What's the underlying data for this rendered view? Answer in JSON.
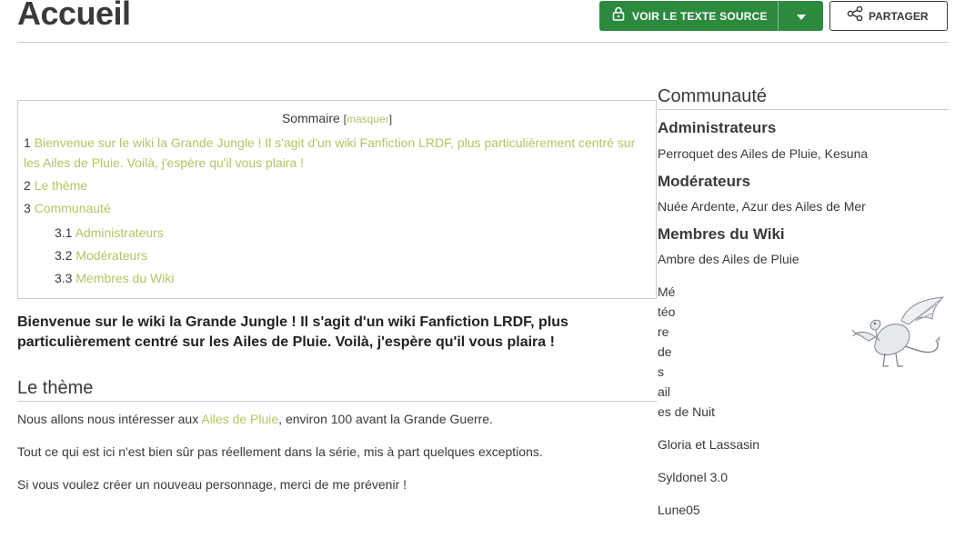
{
  "page": {
    "title": "Accueil"
  },
  "actions": {
    "view_source": "VOIR LE TEXTE SOURCE",
    "share": "PARTAGER"
  },
  "toc": {
    "title": "Sommaire",
    "bracket_open": "[",
    "hide": "masquer",
    "bracket_close": "]",
    "items": [
      {
        "num": "1",
        "label": "Bienvenue sur le wiki la Grande Jungle ! Il s'agit d'un wiki Fanfiction LRDF, plus particulièrement centré sur les Ailes de Pluie. Voilà, j'espère qu'il vous plaira !"
      },
      {
        "num": "2",
        "label": "Le thème"
      },
      {
        "num": "3",
        "label": "Communauté"
      },
      {
        "num": "3.1",
        "label": "Administrateurs"
      },
      {
        "num": "3.2",
        "label": "Modérateurs"
      },
      {
        "num": "3.3",
        "label": "Membres du Wiki"
      }
    ]
  },
  "content": {
    "intro": "Bienvenue sur le wiki la Grande Jungle ! Il s'agit d'un wiki Fanfiction LRDF, plus particulièrement centré sur les Ailes de Pluie. Voilà, j'espère qu'il vous plaira !",
    "theme_heading": "Le thème",
    "p1_before": "Nous allons nous intéresser aux ",
    "p1_link": "Ailes de Pluie",
    "p1_after": ", environ 100 avant la Grande Guerre.",
    "p2": "Tout ce qui est ici n'est bien sûr pas réellement dans la série, mis à part quelques exceptions.",
    "p3": "Si vous voulez créer un nouveau personnage, merci de me prévenir !"
  },
  "community": {
    "title": "Communauté",
    "admins_heading": "Administrateurs",
    "admins": "Perroquet des Ailes de Pluie, Kesuna",
    "mods_heading": "Modérateurs",
    "mods": "Nuée Ardente, Azur des Ailes de Mer",
    "members_heading": "Membres du Wiki",
    "members": [
      "Ambre des Ailes de Pluie",
      "Météore des ailes de Nuit",
      "Gloria et Lassasin",
      "Syldonel 3.0",
      "Lune05"
    ],
    "member2_fragments": [
      "Mé",
      "téo",
      "re",
      "de",
      "s",
      "ail",
      "es de Nuit"
    ]
  },
  "icons": {
    "lock": "lock-icon",
    "caret": "caret-down-icon",
    "share": "share-icon",
    "dragon": "dragon-image"
  },
  "colors": {
    "accent_green": "#2b8a3e",
    "link": "#b5c463",
    "text": "#3a3a3a"
  }
}
